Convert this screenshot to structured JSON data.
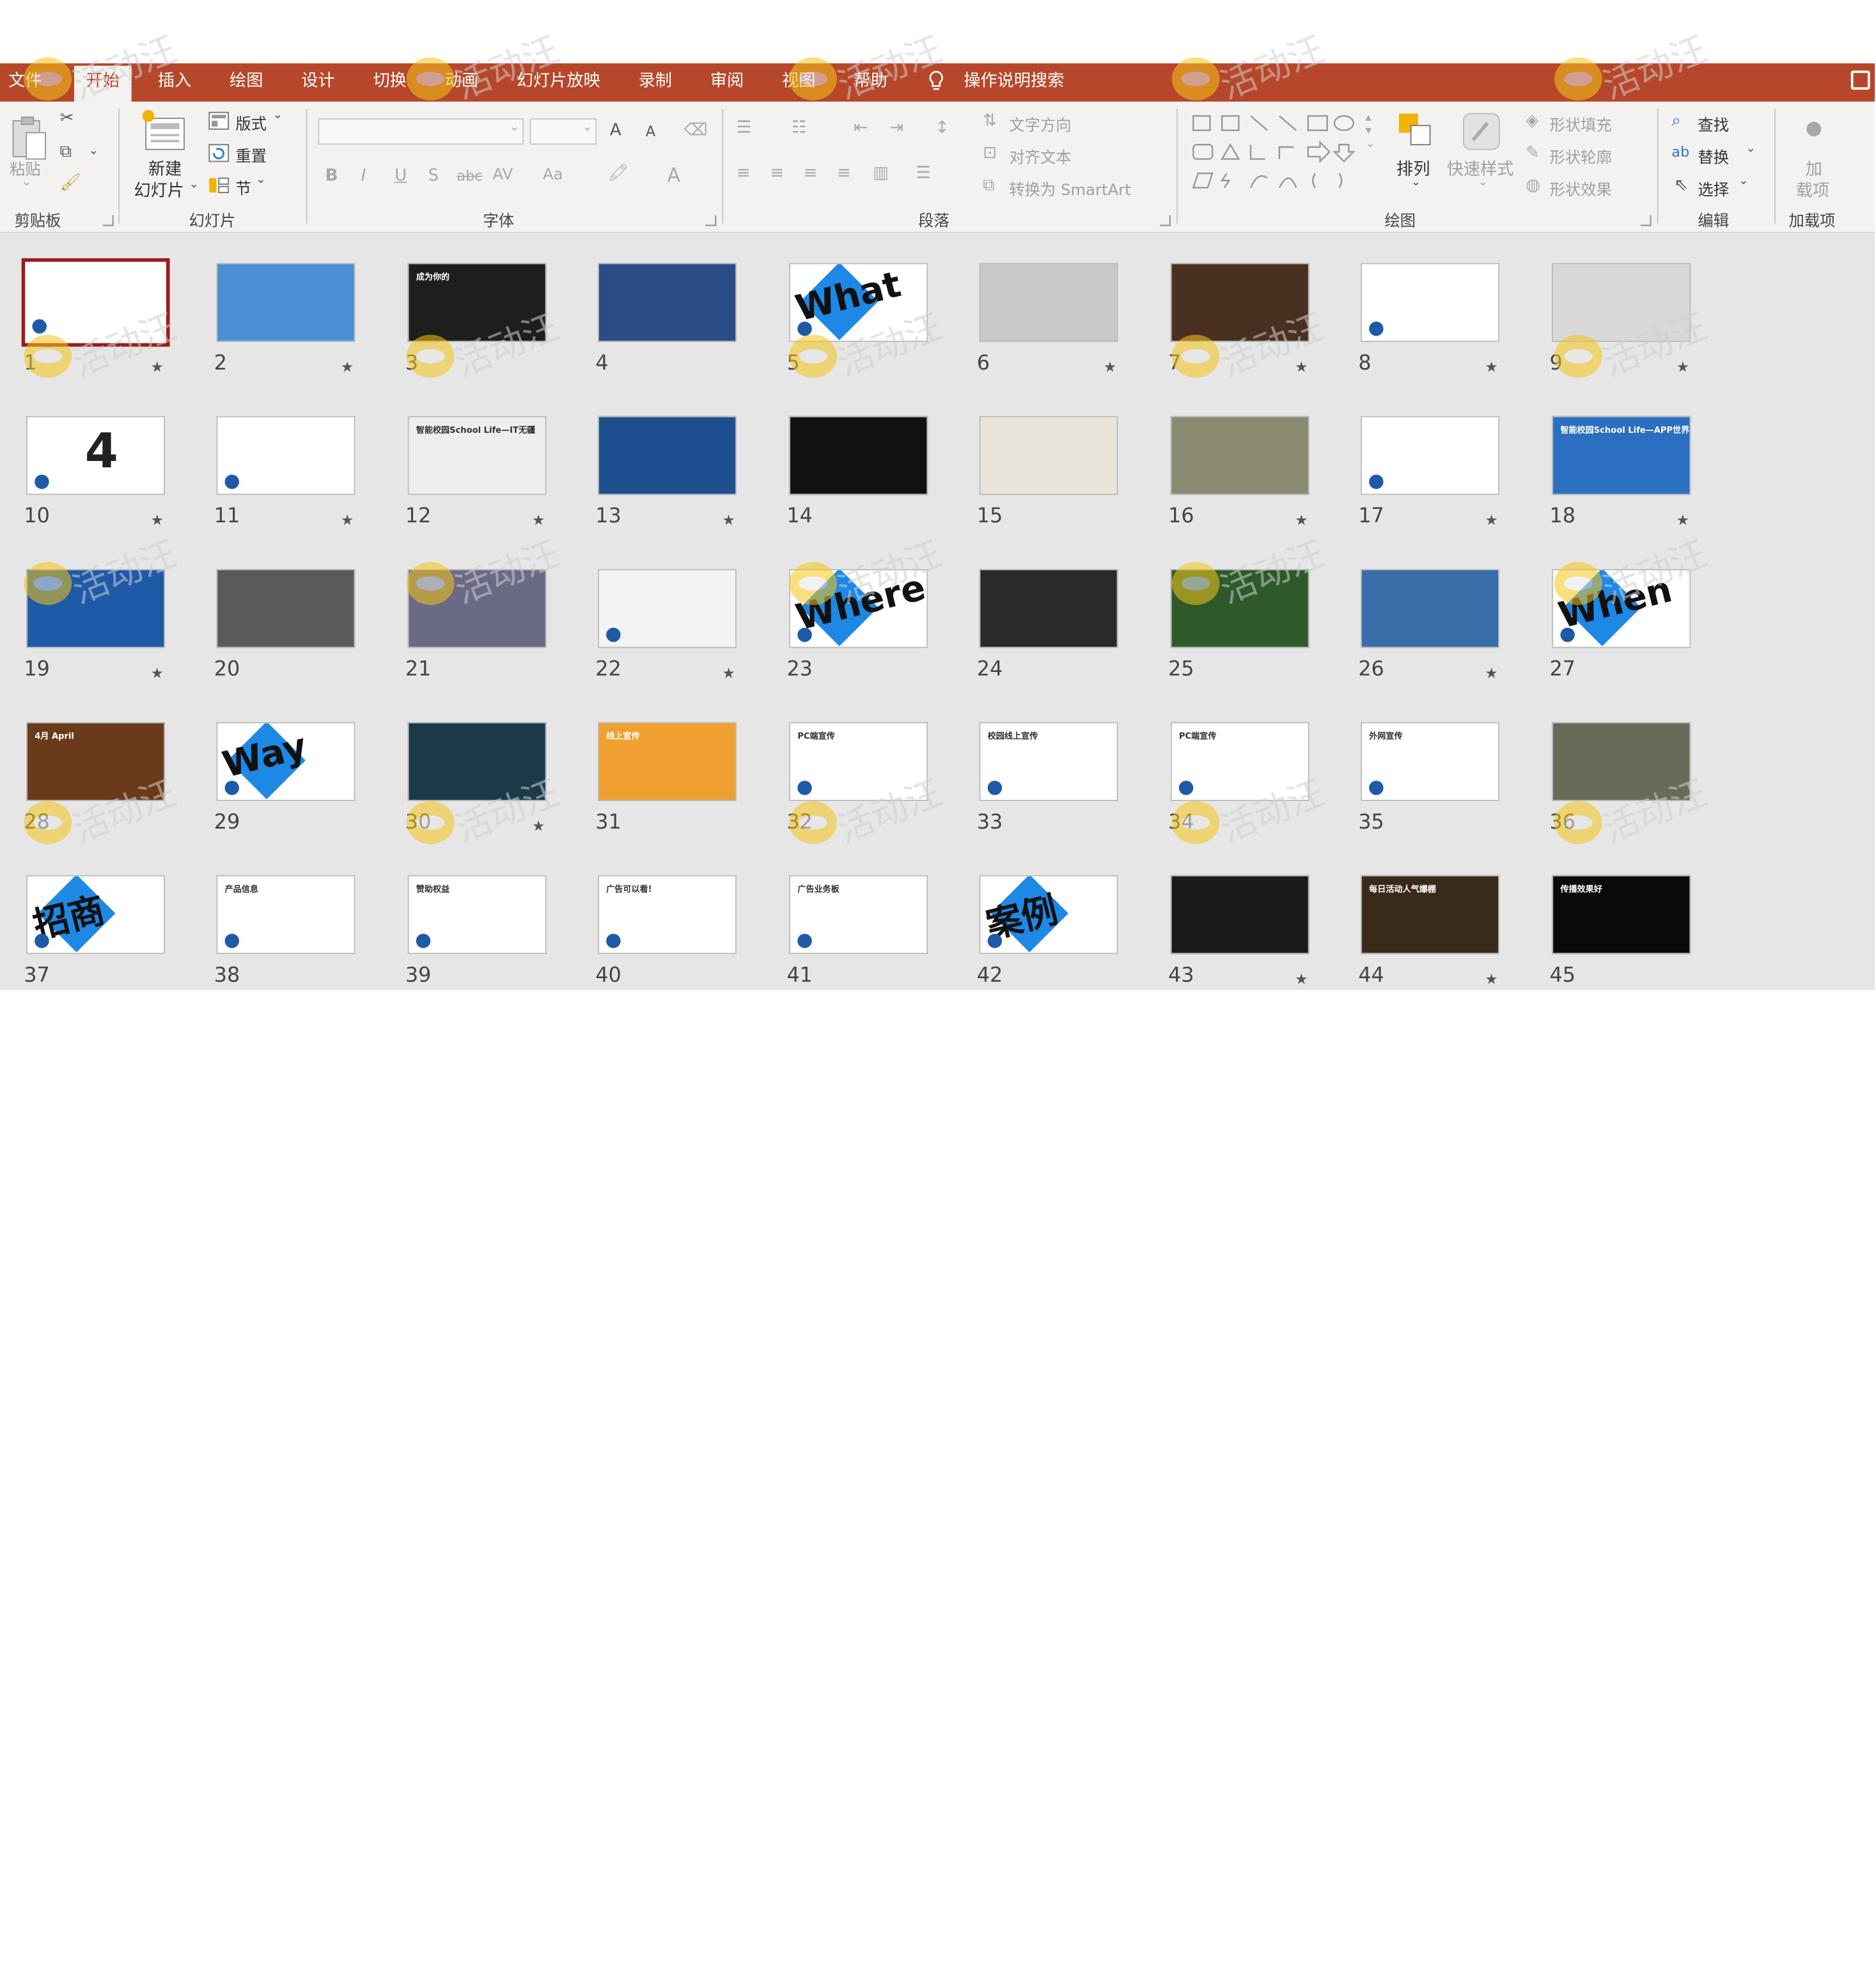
{
  "tabs": [
    "文件",
    "开始",
    "插入",
    "绘图",
    "设计",
    "切换",
    "动画",
    "幻灯片放映",
    "录制",
    "审阅",
    "视图",
    "帮助"
  ],
  "active_tab": "开始",
  "tell_me": "操作说明搜索",
  "clipboard": {
    "paste": "粘贴",
    "label": "剪贴板"
  },
  "slides_group": {
    "new_slide_line1": "新建",
    "new_slide_line2": "幻灯片",
    "layout": "版式",
    "reset": "重置",
    "section": "节",
    "label": "幻灯片"
  },
  "font_group": {
    "label": "字体",
    "bold": "B",
    "italic": "I",
    "underline": "U",
    "shadow": "S",
    "strike": "abc",
    "spacing": "AV",
    "case": "Aa",
    "grow": "A",
    "shrink": "A",
    "color": "A"
  },
  "paragraph_group": {
    "label": "段落",
    "text_direction": "文字方向",
    "align_text": "对齐文本",
    "smartart": "转换为 SmartArt"
  },
  "drawing_group": {
    "label": "绘图",
    "arrange": "排列",
    "quick_styles": "快速样式",
    "shape_fill": "形状填充",
    "shape_outline": "形状轮廓",
    "shape_effects": "形状效果"
  },
  "editing_group": {
    "label": "编辑",
    "find": "查找",
    "replace": "替换",
    "select": "选择"
  },
  "addins_group": {
    "label": "加载项",
    "btn_line1": "加",
    "btn_line2": "载项"
  },
  "watermark_text": "活动汪",
  "colors": {
    "accent": "#b7472a",
    "ribbon": "#f3f2f1",
    "sorter": "#e6e6e6",
    "selection": "#9c1c1c"
  },
  "slides": [
    {
      "n": "1",
      "star": true,
      "bg": "#ffffff",
      "text": "",
      "selected": true
    },
    {
      "n": "2",
      "star": true,
      "bg": "#4a8fd4",
      "text": ""
    },
    {
      "n": "3",
      "star": false,
      "bg": "#1e1e1e",
      "text": "成为你的"
    },
    {
      "n": "4",
      "star": false,
      "bg": "#2a4c86",
      "text": ""
    },
    {
      "n": "5",
      "star": false,
      "bg": "#ffffff",
      "text": "What"
    },
    {
      "n": "6",
      "star": true,
      "bg": "#c9c9c9",
      "text": ""
    },
    {
      "n": "7",
      "star": true,
      "bg": "#4a3020",
      "text": ""
    },
    {
      "n": "8",
      "star": true,
      "bg": "#ffffff",
      "text": ""
    },
    {
      "n": "9",
      "star": true,
      "bg": "#d8d8d8",
      "text": ""
    },
    {
      "n": "10",
      "star": true,
      "bg": "#ffffff",
      "text": "4"
    },
    {
      "n": "11",
      "star": true,
      "bg": "#ffffff",
      "text": ""
    },
    {
      "n": "12",
      "star": true,
      "bg": "#eeeeee",
      "text": "智能校园School Life—IT无疆"
    },
    {
      "n": "13",
      "star": true,
      "bg": "#1d4f8f",
      "text": ""
    },
    {
      "n": "14",
      "star": false,
      "bg": "#111111",
      "text": ""
    },
    {
      "n": "15",
      "star": false,
      "bg": "#e8e4da",
      "text": ""
    },
    {
      "n": "16",
      "star": true,
      "bg": "#8a8a70",
      "text": ""
    },
    {
      "n": "17",
      "star": true,
      "bg": "#ffffff",
      "text": ""
    },
    {
      "n": "18",
      "star": true,
      "bg": "#2a6fc0",
      "text": "智能校园School Life—APP世界"
    },
    {
      "n": "19",
      "star": true,
      "bg": "#1e5aa8",
      "text": ""
    },
    {
      "n": "20",
      "star": false,
      "bg": "#5a5a5a",
      "text": ""
    },
    {
      "n": "21",
      "star": false,
      "bg": "#6a6a86",
      "text": ""
    },
    {
      "n": "22",
      "star": true,
      "bg": "#f4f4f4",
      "text": ""
    },
    {
      "n": "23",
      "star": false,
      "bg": "#ffffff",
      "text": "Where"
    },
    {
      "n": "24",
      "star": false,
      "bg": "#2a2a2a",
      "text": ""
    },
    {
      "n": "25",
      "star": false,
      "bg": "#2e5a2a",
      "text": ""
    },
    {
      "n": "26",
      "star": true,
      "bg": "#3a6ea8",
      "text": ""
    },
    {
      "n": "27",
      "star": false,
      "bg": "#ffffff",
      "text": "When"
    },
    {
      "n": "28",
      "star": false,
      "bg": "#6a3a1a",
      "text": "4月 April"
    },
    {
      "n": "29",
      "star": false,
      "bg": "#ffffff",
      "text": "Way"
    },
    {
      "n": "30",
      "star": true,
      "bg": "#1a3a4a",
      "text": ""
    },
    {
      "n": "31",
      "star": false,
      "bg": "#f0a030",
      "text": "线上宣传"
    },
    {
      "n": "32",
      "star": false,
      "bg": "#ffffff",
      "text": "PC端宣传"
    },
    {
      "n": "33",
      "star": false,
      "bg": "#ffffff",
      "text": "校园线上宣传"
    },
    {
      "n": "34",
      "star": false,
      "bg": "#ffffff",
      "text": "PC端宣传"
    },
    {
      "n": "35",
      "star": false,
      "bg": "#ffffff",
      "text": "外网宣传"
    },
    {
      "n": "36",
      "star": false,
      "bg": "#6a6a5a",
      "text": ""
    },
    {
      "n": "37",
      "star": false,
      "bg": "#ffffff",
      "text": "招商"
    },
    {
      "n": "38",
      "star": false,
      "bg": "#ffffff",
      "text": "产品信息"
    },
    {
      "n": "39",
      "star": false,
      "bg": "#ffffff",
      "text": "赞助权益"
    },
    {
      "n": "40",
      "star": false,
      "bg": "#ffffff",
      "text": "广告可以看!"
    },
    {
      "n": "41",
      "star": false,
      "bg": "#ffffff",
      "text": "广告业务板"
    },
    {
      "n": "42",
      "star": false,
      "bg": "#ffffff",
      "text": "案例"
    },
    {
      "n": "43",
      "star": true,
      "bg": "#1a1a1a",
      "text": ""
    },
    {
      "n": "44",
      "star": true,
      "bg": "#3a2a1a",
      "text": "每日活动人气爆棚"
    },
    {
      "n": "45",
      "star": false,
      "bg": "#0a0a0a",
      "text": "传播效果好"
    }
  ]
}
